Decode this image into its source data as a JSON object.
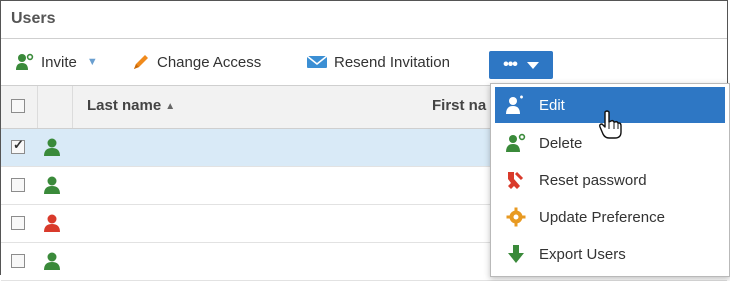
{
  "title": "Users",
  "toolbar": {
    "invite_label": "Invite",
    "change_access_label": "Change Access",
    "resend_label": "Resend Invitation",
    "more_label": "•••"
  },
  "grid": {
    "columns": {
      "last_name": "Last name",
      "first_name": "First na"
    },
    "rows": [
      {
        "checked": true,
        "status": "active",
        "selected": true
      },
      {
        "checked": false,
        "status": "active",
        "selected": false
      },
      {
        "checked": false,
        "status": "disabled",
        "selected": false
      },
      {
        "checked": false,
        "status": "active",
        "selected": false
      }
    ]
  },
  "menu": {
    "items": [
      {
        "label": "Edit",
        "icon": "user-edit-icon"
      },
      {
        "label": "Delete",
        "icon": "user-delete-icon"
      },
      {
        "label": "Reset password",
        "icon": "key-icon"
      },
      {
        "label": "Update Preference",
        "icon": "gear-icon"
      },
      {
        "label": "Export Users",
        "icon": "download-arrow-icon"
      }
    ]
  },
  "colors": {
    "accent": "#2e77c4",
    "user_active": "#3a8a3a",
    "user_disabled": "#d93a2b",
    "selected_row": "#d9eaf7"
  }
}
